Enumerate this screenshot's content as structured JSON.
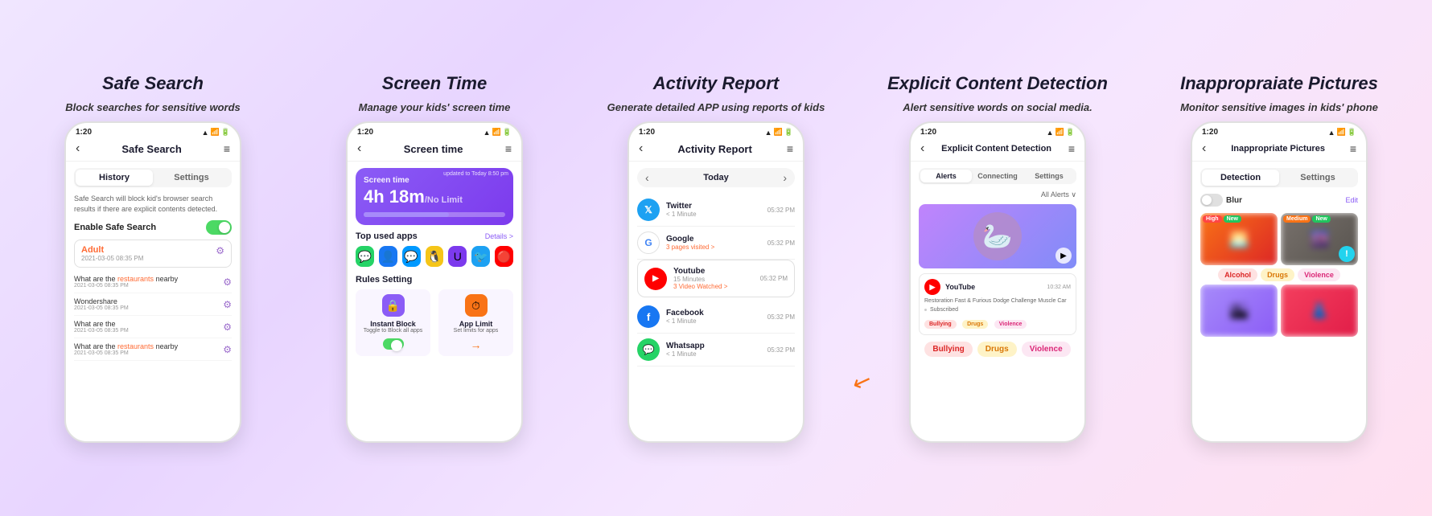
{
  "features": [
    {
      "id": "safe-search",
      "title": "Safe Search",
      "description": "Block searches for sensitive words",
      "phone": {
        "status_time": "1:20",
        "header_title": "Safe Search",
        "tabs": [
          "History",
          "Settings"
        ],
        "active_tab": "History",
        "info_text": "Safe Search will block kid's browser search results if there are explicit contents detected.",
        "toggle_label": "Enable Safe Search",
        "toggle_on": true,
        "alert_word": "Adult",
        "alert_time": "2021-03-05 08:35 PM",
        "search_items": [
          {
            "text": "What are the restaurants nearby",
            "date": "2021-03-05 08:35 PM"
          },
          {
            "text": "Wondershare",
            "date": "2021-03-05 08:35 PM"
          },
          {
            "text": "What are the",
            "date": "2021-03-05 08:35 PM"
          },
          {
            "text": "What are the restaurants nearby",
            "date": "2021-03-05 08:35 PM"
          }
        ]
      }
    },
    {
      "id": "screen-time",
      "title": "Screen Time",
      "description": "Manage your kids' screen time",
      "phone": {
        "status_time": "1:20",
        "header_title": "Screen time",
        "screen_time_label": "Screen time",
        "screen_time_value": "4h 18m",
        "screen_time_limit": "/No Limit",
        "updated_text": "updated to Today 8:50 pm",
        "top_apps_title": "Top used apps",
        "details_label": "Details >",
        "apps": [
          "💬",
          "👤",
          "💬",
          "🐧",
          "🟣",
          "🐦",
          "🔴"
        ],
        "rules_title": "Rules Setting",
        "rules": [
          {
            "title": "Instant Block",
            "description": "Toggle to Block all apps",
            "color": "purple"
          },
          {
            "title": "App Limit",
            "description": "Set limits for apps",
            "color": "orange"
          }
        ]
      }
    },
    {
      "id": "activity-report",
      "title": "Activity Report",
      "description": "Generate detailed APP using reports of kids",
      "phone": {
        "status_time": "1:20",
        "header_title": "Activity Report",
        "date_label": "Today",
        "activities": [
          {
            "app": "Twitter",
            "sub": "< 1 Minute",
            "time": "05:32 PM",
            "type": "twitter"
          },
          {
            "app": "Google",
            "sub": "3 pages visited >",
            "time": "05:32 PM",
            "type": "google"
          },
          {
            "app": "Youtube",
            "sub": "15 Minutes",
            "sub2": "3 Video Watched >",
            "time": "05:32 PM",
            "type": "youtube",
            "highlighted": true
          },
          {
            "app": "Facebook",
            "sub": "< 1 Minute",
            "time": "05:32 PM",
            "type": "facebook"
          },
          {
            "app": "Whatsapp",
            "sub": "< 1 Minute",
            "time": "05:32 PM",
            "type": "whatsapp"
          }
        ]
      }
    },
    {
      "id": "explicit-content",
      "title": "Explicit Content Detection",
      "description": "Alert sensitive words on social media.",
      "phone": {
        "status_time": "1:20",
        "header_title": "Explicit Content Detection",
        "tabs": [
          "Alerts",
          "Connecting",
          "Settings"
        ],
        "active_tab": "Alerts",
        "filter_label": "All Alerts ∨",
        "video_title": "YouTube",
        "video_time": "10:32 AM",
        "video_desc": "Restoration Fast & Furious Dodge Challenge Muscle Car",
        "subscribed": "Subscribed",
        "tags_video": [
          "Bullying",
          "Drugs",
          "Violence"
        ],
        "tags_bottom": [
          "Bullying",
          "Drugs",
          "Violence"
        ]
      }
    },
    {
      "id": "inappropriate-pictures",
      "title": "Inappropraiate Pictures",
      "description": "Monitor sensitive images in kids' phone",
      "phone": {
        "status_time": "1:20",
        "header_title": "Inappropriate Pictures",
        "tabs": [
          "Detection",
          "Settings"
        ],
        "active_tab": "Detection",
        "blur_label": "Blur",
        "edit_label": "Edit",
        "image_badges": [
          [
            "High",
            "New"
          ],
          [
            "Medium",
            "New"
          ]
        ],
        "tags": [
          "Alcohol",
          "Drugs",
          "Violence"
        ]
      }
    }
  ],
  "colors": {
    "primary_purple": "#8b5cf6",
    "orange_accent": "#f97316",
    "red_tag": "#dc2626",
    "yellow_tag": "#d97706",
    "pink_tag": "#db2777"
  }
}
